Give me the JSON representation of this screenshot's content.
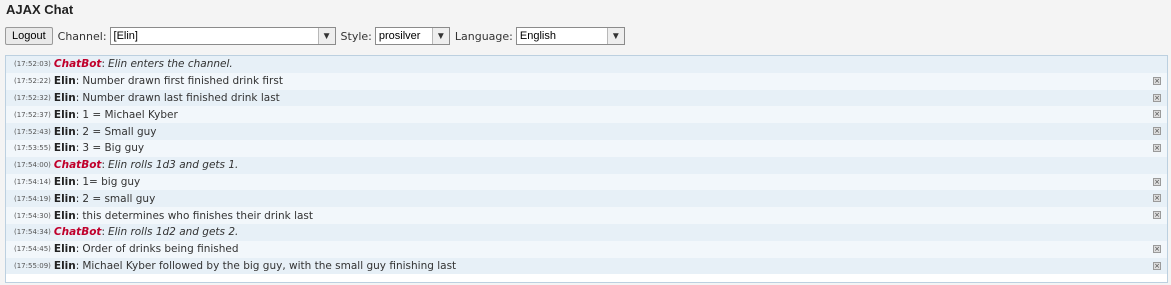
{
  "app": {
    "title": "AJAX Chat"
  },
  "toolbar": {
    "logout_label": "Logout",
    "channel_label": "Channel:",
    "channel_value": "[Elin]",
    "style_label": "Style:",
    "style_value": "prosilver",
    "language_label": "Language:",
    "language_value": "English"
  },
  "messages": [
    {
      "time": "(17:52:03)",
      "user": "ChatBot",
      "text": "Elin enters the channel.",
      "bot": true
    },
    {
      "time": "(17:52:22)",
      "user": "Elin",
      "text": "Number drawn first finished drink first",
      "bot": false
    },
    {
      "time": "(17:52:32)",
      "user": "Elin",
      "text": "Number drawn last finished drink last",
      "bot": false
    },
    {
      "time": "(17:52:37)",
      "user": "Elin",
      "text": "1 = Michael Kyber",
      "bot": false
    },
    {
      "time": "(17:52:43)",
      "user": "Elin",
      "text": "2 = Small guy",
      "bot": false
    },
    {
      "time": "(17:53:55)",
      "user": "Elin",
      "text": "3 = Big guy",
      "bot": false
    },
    {
      "time": "(17:54:00)",
      "user": "ChatBot",
      "text": "Elin rolls 1d3 and gets 1.",
      "bot": true
    },
    {
      "time": "(17:54:14)",
      "user": "Elin",
      "text": "1= big guy",
      "bot": false
    },
    {
      "time": "(17:54:19)",
      "user": "Elin",
      "text": "2 = small guy",
      "bot": false
    },
    {
      "time": "(17:54:30)",
      "user": "Elin",
      "text": "this determines who finishes their drink last",
      "bot": false
    },
    {
      "time": "(17:54:34)",
      "user": "ChatBot",
      "text": "Elin rolls 1d2 and gets 2.",
      "bot": true
    },
    {
      "time": "(17:54:45)",
      "user": "Elin",
      "text": "Order of drinks being finished",
      "bot": false
    },
    {
      "time": "(17:55:09)",
      "user": "Elin",
      "text": "Michael Kyber followed by the big guy, with the small guy finishing last",
      "bot": false
    }
  ]
}
